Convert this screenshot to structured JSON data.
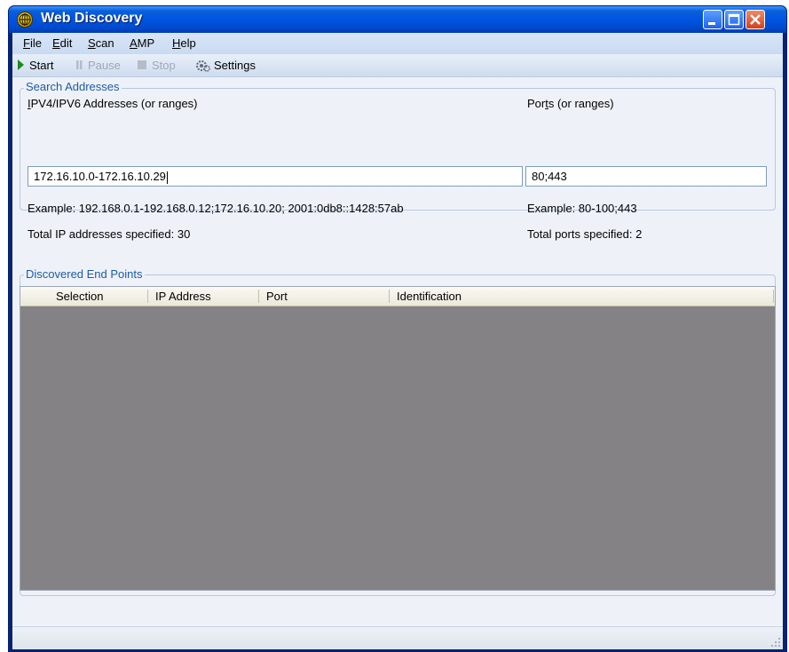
{
  "window": {
    "title": "Web Discovery"
  },
  "menu": {
    "items": [
      {
        "label": "File",
        "mnemonic": "F",
        "rest": "ile"
      },
      {
        "label": "Edit",
        "mnemonic": "E",
        "rest": "dit"
      },
      {
        "label": "Scan",
        "mnemonic": "S",
        "rest": "can"
      },
      {
        "label": "AMP",
        "mnemonic": "A",
        "rest": "MP"
      },
      {
        "label": "Help",
        "mnemonic": "H",
        "rest": "elp"
      }
    ]
  },
  "toolbar": {
    "start": "Start",
    "pause": "Pause",
    "stop": "Stop",
    "settings": "Settings"
  },
  "search": {
    "group_label": "Search Addresses",
    "addresses_label_mnemonic": "I",
    "addresses_label_rest": "PV4/IPV6 Addresses (or ranges)",
    "addresses_value": "172.16.10.0-172.16.10.29",
    "addresses_example": "Example:  192.168.0.1-192.168.0.12;172.16.10.20;  2001:0db8::1428:57ab",
    "addresses_total": "Total IP addresses specified:  30",
    "ports_label_pre": "Por",
    "ports_label_mnemonic": "t",
    "ports_label_rest": "s (or ranges)",
    "ports_value": "80;443",
    "ports_example": "Example: 80-100;443",
    "ports_total": "Total ports specified:  2"
  },
  "results": {
    "group_label": "Discovered End Points",
    "columns": [
      "Selection",
      "IP Address",
      "Port",
      "Identification"
    ]
  },
  "colors": {
    "titlebar": "#0054e3",
    "group_label": "#1d5aa8",
    "list_background": "#858285"
  }
}
